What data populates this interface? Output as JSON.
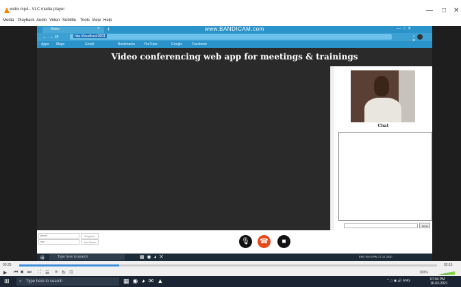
{
  "vlc": {
    "title": "webx.mp4 - VLC media player",
    "window_controls": [
      "—",
      "□",
      "✕"
    ],
    "menu": [
      "Media",
      "Playback",
      "Audio",
      "Video",
      "Subtitle",
      "Tools",
      "View",
      "Help"
    ],
    "time_elapsed": "00:25",
    "time_total": "02:15",
    "progress": 0.24,
    "control_icons": [
      "play-icon",
      "prev-icon",
      "stop-icon",
      "next-icon",
      "fullscreen-icon",
      "extended-settings-icon",
      "playlist-icon",
      "loop-icon",
      "shuffle-icon"
    ],
    "volume": "100%"
  },
  "browser": {
    "tab_label": "Webx",
    "tab_close": "×",
    "new_tab": "+",
    "watermark": "www.BANDICAM.com",
    "url": "http://localhost:3001",
    "url_icons": "☆  ⊕  ○",
    "bookmarks": [
      "Apps",
      "Maps",
      "Gmail",
      "Bookmarks",
      "YouTube",
      "Google",
      "Facebook"
    ]
  },
  "app": {
    "title": "Video conferencing web app for meetings & trainings",
    "chat_label": "Chat",
    "send_label": "Send",
    "room_placeholder": "jhonk",
    "pass_placeholder": "xxx",
    "register_label": "Register",
    "join_label": "Join Room"
  },
  "inner_taskbar": {
    "search_placeholder": "Type here to search",
    "time": "05:03 PM",
    "date": "17-12-2020",
    "lang": "ENG"
  },
  "host_taskbar": {
    "search_placeholder": "Type here to search",
    "time": "07:04 PM",
    "date": "16-03-2021",
    "lang": "ENG"
  },
  "colors": {
    "chrome_blue": "#2a93c9",
    "app_dark": "#2a2a2a",
    "hangup": "#e64a19",
    "vlc_cone": "#f08a00"
  }
}
